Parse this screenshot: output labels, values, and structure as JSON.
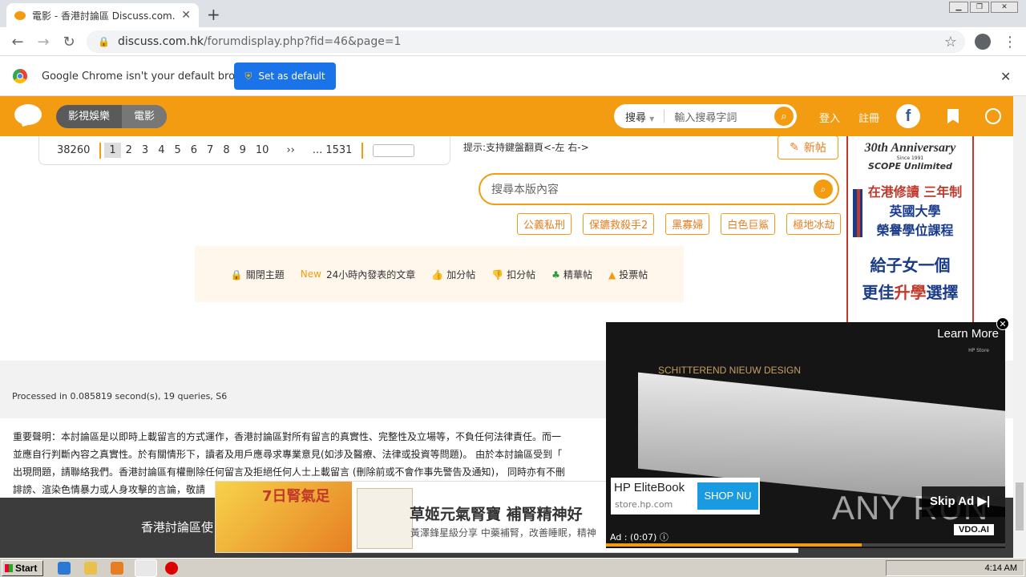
{
  "browser": {
    "tab_title": "電影 - 香港討論區 Discuss.com.hk -",
    "url_domain": "discuss.com.hk",
    "url_path": "/forumdisplay.php?fid=46&page=1",
    "infobar_text": "Google Chrome isn't your default browser",
    "set_default_label": "Set as default"
  },
  "header": {
    "category_main": "影視娛樂",
    "category_sub": "電影",
    "search_scope": "搜尋",
    "search_placeholder": "輸入搜尋字詞",
    "login": "登入",
    "register": "註冊",
    "facebook_letter": "f"
  },
  "pager": {
    "total": "38260",
    "pages": [
      "1",
      "2",
      "3",
      "4",
      "5",
      "6",
      "7",
      "8",
      "9",
      "10"
    ],
    "next": "››",
    "last": "... 1531"
  },
  "hint": "提示:支持鍵盤翻頁<-左 右->",
  "new_post_label": "新帖",
  "forum_search_placeholder": "搜尋本版內容",
  "tags": [
    "公義私刑",
    "保鑣救殺手2",
    "黑寡婦",
    "白色巨鯊",
    "極地冰劫"
  ],
  "filters": {
    "closed": "關閉主題",
    "new_badge": "New",
    "recent": "24小時內發表的文章",
    "plus": "加分帖",
    "minus": "扣分帖",
    "digest": "精華帖",
    "poll": "投票帖"
  },
  "side_ad": {
    "anniversary": "30th Anniversary",
    "since": "Since 1991",
    "brand": "SCOPE Unlimited",
    "line1": "在港修讀 三年制",
    "line2": "英國大學",
    "line3": "榮譽學位課程",
    "line4": "給子女一個",
    "line5a": "更佳",
    "line5b": "升學",
    "line5c": "選擇"
  },
  "processed": "Processed in 0.085819 second(s), 19 queries, S6",
  "disclaimer": [
    "重要聲明：本討論區是以即時上載留言的方式運作，香港討論區對所有留言的真實性、完整性及立場等，不負任何法律責任。而一",
    "並應自行判斷內容之真實性。於有關情形下，讀者及用戶應尋求專業意見(如涉及醫療、法律或投資等問題)。 由於本討論區受到「",
    "出現問題，請聯絡我們。香港討論區有權刪除任何留言及拒絕任何人士上載留言 (刪除前或不會作事先警告及通知)， 同時亦有不刪",
    "誹謗、渲染色情暴力或人身攻擊的言論，敬請"
  ],
  "dark_footer_text": "香港討論區使",
  "bottom_ad": {
    "badge": "7日腎氣足",
    "headline": "草姬元氣腎寶 補腎精神好",
    "sub": "黃澤鋒星級分享 中藥補腎，改善睡眠，精神"
  },
  "video_ad": {
    "design_text": "SCHITTEREND NIEUW DESIGN",
    "learn_more": "Learn More",
    "hp_store": "HP Store",
    "product": "HP EliteBook",
    "store_url": "store.hp.com",
    "shop_label": "SHOP NU",
    "skip_label": "Skip Ad",
    "vdo": "VDO.AI",
    "ad_time": "Ad : (0:07)",
    "watermark": "ANY RUN",
    "progress": 0.64
  },
  "taskbar": {
    "start": "Start",
    "clock": "4:14 AM"
  },
  "colors": {
    "brand_orange": "#f39c12",
    "chrome_blue": "#1a73e8"
  }
}
